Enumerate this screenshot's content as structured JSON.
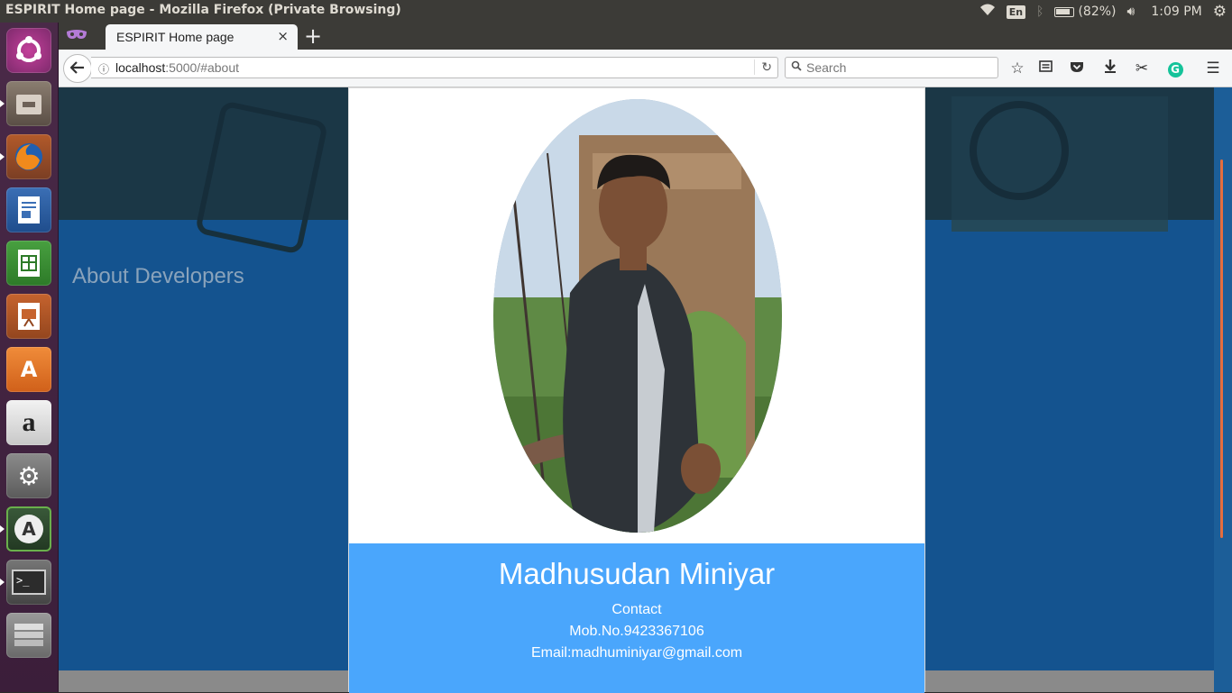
{
  "system": {
    "window_title": "ESPIRIT Home page - Mozilla Firefox (Private Browsing)",
    "keyboard": "En",
    "battery": "(82%)",
    "time": "1:09 PM"
  },
  "launcher": {
    "items": [
      "ubuntu-dash",
      "files",
      "firefox",
      "writer",
      "calc",
      "impress",
      "software-center",
      "amazon",
      "system-settings",
      "software-updater",
      "terminal",
      "workspaces"
    ]
  },
  "browser": {
    "tab": {
      "title": "ESPIRIT Home page",
      "close": "×"
    },
    "new_tab": "+",
    "url_host": "localhost",
    "url_path": ":5000/#about",
    "search_placeholder": "Search"
  },
  "page": {
    "section_title": "About Developers"
  },
  "card": {
    "name": "Madhusudan Miniyar",
    "contact_label": "Contact",
    "mobile": "Mob.No.9423367106",
    "email": "Email:madhuminiyar@gmail.com"
  },
  "colors": {
    "page_bg": "#14538f",
    "info_panel": "#4aa6fc",
    "launcher": "#4a2a48",
    "scroll_thumb": "#e56d3d"
  }
}
